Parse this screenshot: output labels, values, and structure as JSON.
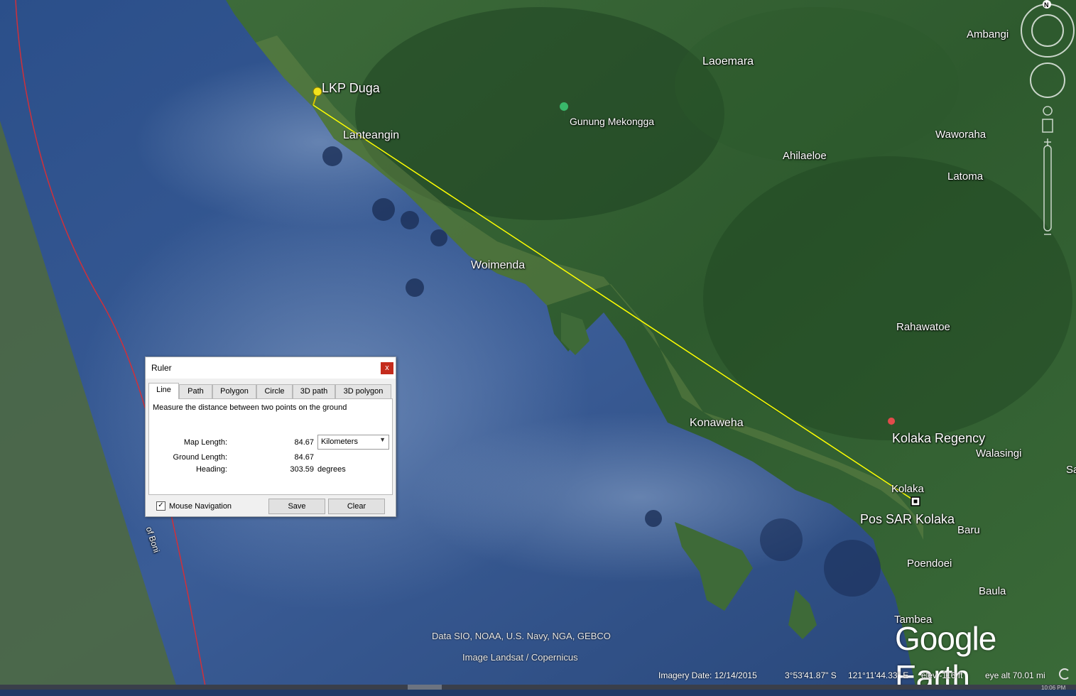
{
  "map": {
    "places": [
      {
        "name": "LKP Duga"
      },
      {
        "name": "Lanteangin"
      },
      {
        "name": "Gunung Mekongga"
      },
      {
        "name": "Laoemara"
      },
      {
        "name": "Ambangi"
      },
      {
        "name": "Waworaha"
      },
      {
        "name": "Ahilaeloe"
      },
      {
        "name": "Latoma"
      },
      {
        "name": "Woimenda"
      },
      {
        "name": "Rahawatoe"
      },
      {
        "name": "Konaweha"
      },
      {
        "name": "Kolaka Regency"
      },
      {
        "name": "Walasingi"
      },
      {
        "name": "Sa"
      },
      {
        "name": "Kolaka"
      },
      {
        "name": "Pos SAR Kolaka"
      },
      {
        "name": "Baru"
      },
      {
        "name": "Poendoei"
      },
      {
        "name": "Baula"
      },
      {
        "name": "Tambea"
      }
    ],
    "boundary_label": "of Boni",
    "credits": {
      "data": "Data SIO, NOAA, U.S. Navy, NGA, GEBCO",
      "image": "Image Landsat / Copernicus"
    },
    "logo": "Google Earth",
    "compass_label": "N"
  },
  "status": {
    "imagery_date": "Imagery Date: 12/14/2015",
    "lat": "3°53'41.87\" S",
    "lon": "121°11'44.33\" E",
    "elev": "elev  -116 ft",
    "eye_alt": "eye alt  70.01 mi",
    "clock": "10:06 PM"
  },
  "ruler": {
    "title": "Ruler",
    "close_label": "x",
    "tabs": [
      "Line",
      "Path",
      "Polygon",
      "Circle",
      "3D path",
      "3D polygon"
    ],
    "active_tab": "Line",
    "description": "Measure the distance between two points on the ground",
    "map_length_label": "Map Length:",
    "map_length_value": "84.67",
    "unit_selected": "Kilometers",
    "ground_length_label": "Ground Length:",
    "ground_length_value": "84.67",
    "heading_label": "Heading:",
    "heading_value": "303.59",
    "heading_unit": "degrees",
    "mouse_navigation_label": "Mouse Navigation",
    "mouse_navigation_checked": true,
    "save_label": "Save",
    "clear_label": "Clear"
  },
  "colors": {
    "measure_line": "#ffff00",
    "close_button": "#c42b1c",
    "placemark_pin": "#f2e21c",
    "poi_marker": "#e24b4b"
  }
}
